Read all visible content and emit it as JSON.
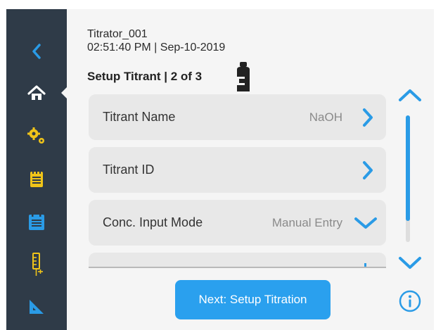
{
  "header": {
    "device_name": "Titrator_001",
    "datetime": "02:51:40 PM | Sep-10-2019"
  },
  "page": {
    "title": "Setup Titrant | 2 of 3"
  },
  "rows": [
    {
      "label": "Titrant Name",
      "value": "NaOH",
      "icon": "chevron-right-icon"
    },
    {
      "label": "Titrant ID",
      "value": "",
      "icon": "chevron-right-icon"
    },
    {
      "label": "Conc. Input Mode",
      "value": "Manual Entry",
      "icon": "chevron-down-icon"
    }
  ],
  "sidebar": {
    "items": [
      {
        "icon": "back-arrow-icon"
      },
      {
        "icon": "home-icon",
        "active": true
      },
      {
        "icon": "gears-icon"
      },
      {
        "icon": "notepad-icon"
      },
      {
        "icon": "calendar-list-icon"
      },
      {
        "icon": "burette-icon"
      },
      {
        "icon": "ruler-triangle-icon"
      }
    ]
  },
  "scroll": {
    "position": 0.0,
    "visible_fraction": 0.83
  },
  "footer": {
    "next_label": "Next: Setup Titration"
  },
  "colors": {
    "sidebar_bg": "#2f3b48",
    "accent": "#2a9be6",
    "row_bg": "#e8e8e8",
    "page_bg": "#f5f5f5"
  }
}
